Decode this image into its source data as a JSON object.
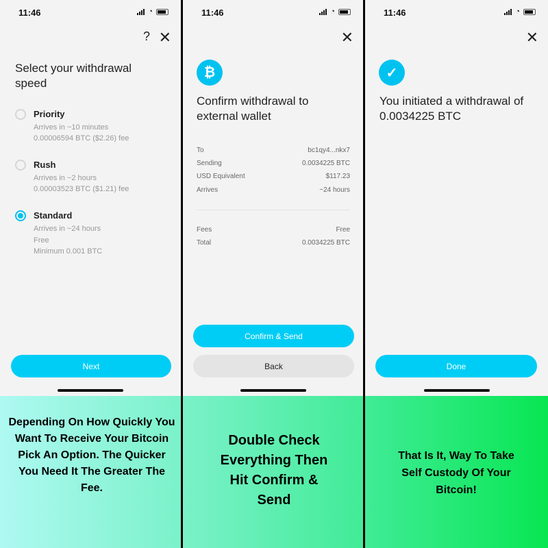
{
  "status": {
    "time": "11:46"
  },
  "screen1": {
    "title": "Select your withdrawal speed",
    "options": [
      {
        "name": "Priority",
        "lines": [
          "Arrives in ~10 minutes",
          "0.00006594 BTC ($2.26) fee"
        ],
        "selected": false
      },
      {
        "name": "Rush",
        "lines": [
          "Arrives in ~2 hours",
          "0.00003523 BTC ($1.21) fee"
        ],
        "selected": false
      },
      {
        "name": "Standard",
        "lines": [
          "Arrives in ~24 hours",
          "Free",
          "Minimum 0.001 BTC"
        ],
        "selected": true
      }
    ],
    "next": "Next",
    "help": "?",
    "close": "✕"
  },
  "screen2": {
    "icon": "₿",
    "title": "Confirm withdrawal to external wallet",
    "rows": [
      {
        "label": "To",
        "value": "bc1qy4...nkx7"
      },
      {
        "label": "Sending",
        "value": "0.0034225 BTC"
      },
      {
        "label": "USD Equivalent",
        "value": "$117.23"
      },
      {
        "label": "Arrives",
        "value": "~24 hours"
      }
    ],
    "rows2": [
      {
        "label": "Fees",
        "value": "Free"
      },
      {
        "label": "Total",
        "value": "0.0034225 BTC"
      }
    ],
    "confirm": "Confirm & Send",
    "back": "Back",
    "close": "✕"
  },
  "screen3": {
    "icon": "✓",
    "title": "You initiated a withdrawal of 0.0034225 BTC",
    "done": "Done",
    "close": "✕"
  },
  "captions": [
    "Depending On How Quickly You Want To Receive Your Bitcoin Pick An Option. The Quicker You Need It The Greater The Fee.",
    "Double Check Everything Then Hit Confirm & Send",
    "That Is It, Way To Take Self Custody Of Your Bitcoin!"
  ],
  "colors": {
    "accent": "#00c2f0",
    "gradient_start": "#aef9f2",
    "gradient_end": "#08e652"
  }
}
